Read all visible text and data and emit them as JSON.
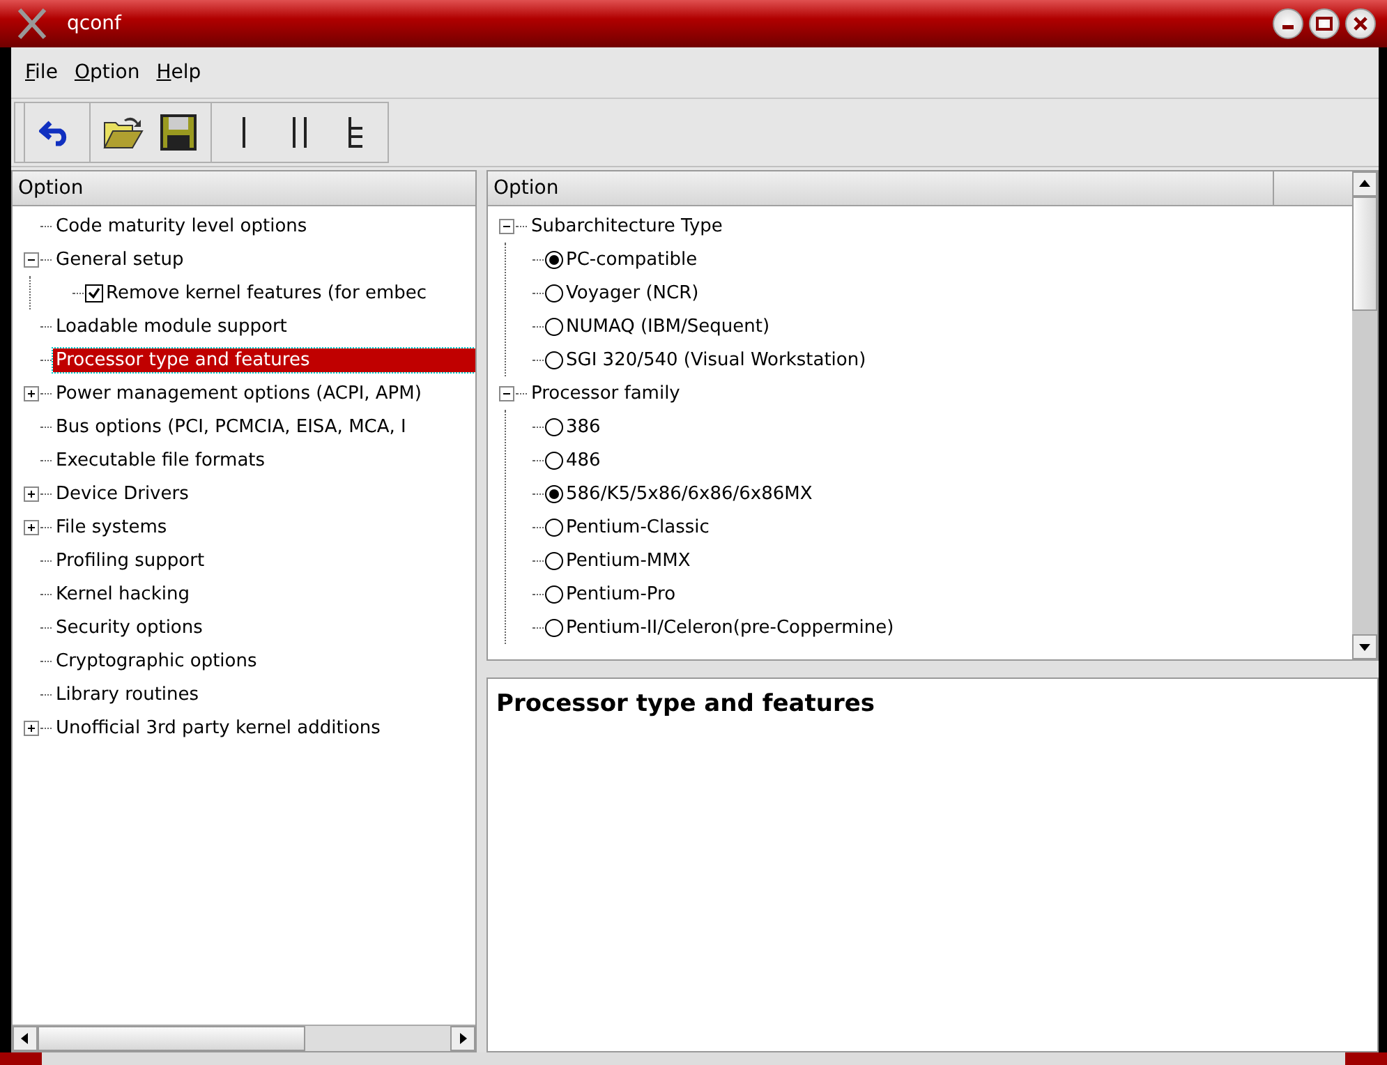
{
  "window": {
    "title": "qconf"
  },
  "menu": [
    {
      "mnemonic": "F",
      "rest": "ile"
    },
    {
      "mnemonic": "O",
      "rest": "ption"
    },
    {
      "mnemonic": "H",
      "rest": "elp"
    }
  ],
  "toolbar": [
    {
      "kind": "back"
    },
    {
      "kind": "open"
    },
    {
      "kind": "save"
    },
    {
      "kind": "single"
    },
    {
      "kind": "split"
    },
    {
      "kind": "full"
    }
  ],
  "menu_tree": {
    "header": "Option",
    "items": [
      {
        "label": "Code maturity level options",
        "selected": false
      },
      {
        "label": "General setup",
        "selected": false,
        "expanded": true,
        "children": [
          {
            "label": "Remove kernel features (for embec",
            "selected": false,
            "checked": true
          }
        ]
      },
      {
        "label": "Loadable module support",
        "selected": false
      },
      {
        "label": "Processor type and features",
        "selected": true
      },
      {
        "label": "Power management options (ACPI, APM)",
        "selected": false,
        "expanded": false
      },
      {
        "label": "Bus options (PCI, PCMCIA, EISA, MCA, I",
        "selected": false
      },
      {
        "label": "Executable file formats",
        "selected": false
      },
      {
        "label": "Device Drivers",
        "selected": false,
        "expanded": false
      },
      {
        "label": "File systems",
        "selected": false,
        "expanded": false
      },
      {
        "label": "Profiling support",
        "selected": false
      },
      {
        "label": "Kernel hacking",
        "selected": false
      },
      {
        "label": "Security options",
        "selected": false
      },
      {
        "label": "Cryptographic options",
        "selected": false
      },
      {
        "label": "Library routines",
        "selected": false
      },
      {
        "label": "Unofficial 3rd party kernel additions",
        "selected": false,
        "expanded": false
      }
    ]
  },
  "config_tree": {
    "header": "Option",
    "groups": [
      {
        "label": "Subarchitecture Type",
        "expanded": true,
        "children": [
          {
            "label": "PC-compatible",
            "selected": true
          },
          {
            "label": "Voyager (NCR)",
            "selected": false
          },
          {
            "label": "NUMAQ (IBM/Sequent)",
            "selected": false
          },
          {
            "label": "SGI 320/540 (Visual Workstation)",
            "selected": false
          }
        ]
      },
      {
        "label": "Processor family",
        "expanded": true,
        "children": [
          {
            "label": "386",
            "selected": false
          },
          {
            "label": "486",
            "selected": false
          },
          {
            "label": "586/K5/5x86/6x86/6x86MX",
            "selected": true
          },
          {
            "label": "Pentium-Classic",
            "selected": false
          },
          {
            "label": "Pentium-MMX",
            "selected": false
          },
          {
            "label": "Pentium-Pro",
            "selected": false
          },
          {
            "label": "Pentium-II/Celeron(pre-Coppermine)",
            "selected": false
          }
        ]
      }
    ]
  },
  "help": {
    "title": "Processor type and features"
  }
}
